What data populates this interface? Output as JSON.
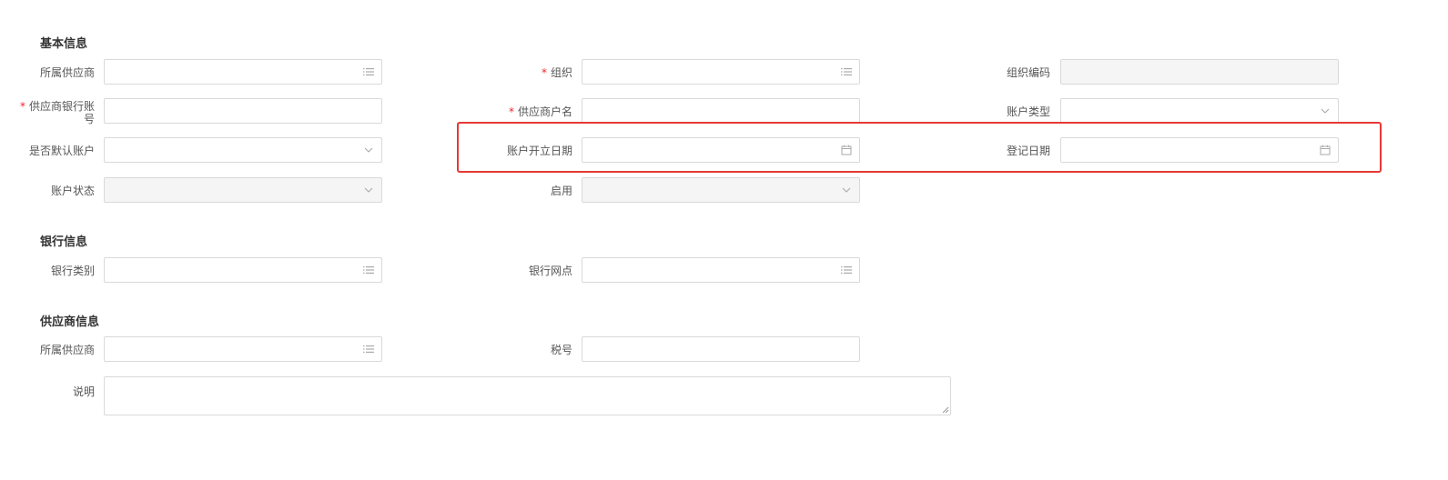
{
  "sections": {
    "basic": {
      "title": "基本信息"
    },
    "bank": {
      "title": "银行信息"
    },
    "supplier": {
      "title": "供应商信息"
    }
  },
  "basic_fields": {
    "supplier": {
      "label": "所属供应商",
      "value": ""
    },
    "org": {
      "label": "组织",
      "required_mark": "*",
      "value": ""
    },
    "org_code": {
      "label": "组织编码",
      "value": ""
    },
    "bank_account": {
      "label_line1": "供应商银行账",
      "label_line2": "号",
      "required_mark": "*",
      "value": ""
    },
    "account_name": {
      "label": "供应商户名",
      "required_mark": "*",
      "value": ""
    },
    "account_type": {
      "label": "账户类型",
      "value": ""
    },
    "is_default": {
      "label": "是否默认账户",
      "value": ""
    },
    "open_date": {
      "label": "账户开立日期",
      "value": ""
    },
    "register_date": {
      "label": "登记日期",
      "value": ""
    },
    "account_status": {
      "label": "账户状态",
      "value": ""
    },
    "enabled": {
      "label": "启用",
      "value": ""
    }
  },
  "bank_fields": {
    "bank_category": {
      "label": "银行类别",
      "value": ""
    },
    "bank_branch": {
      "label": "银行网点",
      "value": ""
    }
  },
  "supplier_fields": {
    "supplier": {
      "label": "所属供应商",
      "value": ""
    },
    "tax_no": {
      "label": "税号",
      "value": ""
    },
    "description": {
      "label": "说明",
      "value": ""
    }
  },
  "icons": {
    "list": "list-icon",
    "dropdown": "chevron-down-icon",
    "calendar": "calendar-icon"
  },
  "colors": {
    "required": "#f5222d",
    "highlight": "#e53935",
    "border": "#d9d9d9",
    "disabled_bg": "#f5f5f5"
  }
}
